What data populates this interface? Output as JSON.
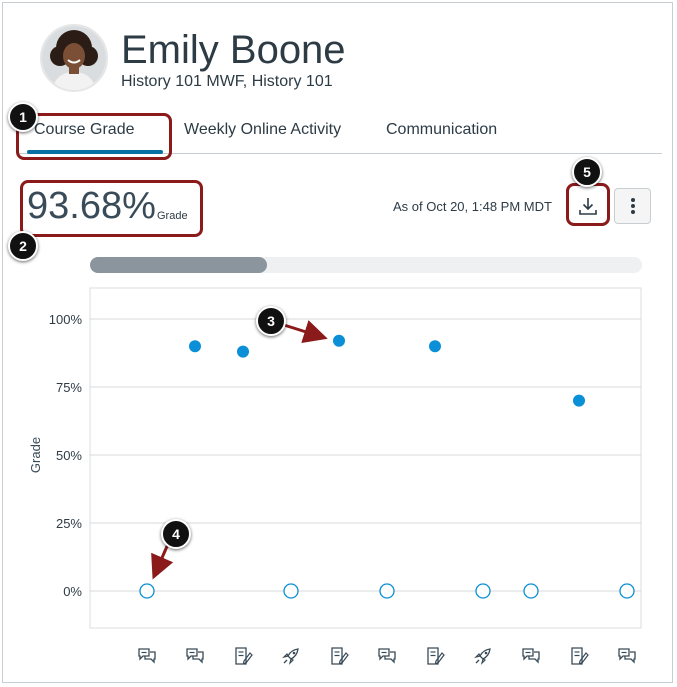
{
  "student": {
    "name": "Emily Boone",
    "course": "History 101 MWF, History 101"
  },
  "tabs": [
    {
      "label": "Course Grade",
      "active": true
    },
    {
      "label": "Weekly Online Activity",
      "active": false
    },
    {
      "label": "Communication",
      "active": false
    }
  ],
  "grade": {
    "value": "93.68%",
    "label": "Grade",
    "as_of": "As of Oct 20, 1:48 PM MDT"
  },
  "scrollbar": {
    "visible_fraction": 0.32
  },
  "callouts": [
    "1",
    "2",
    "3",
    "4",
    "5"
  ],
  "icons": {
    "download": "download-icon",
    "more": "more-vertical-icon",
    "assignment_types": [
      "discussion",
      "discussion",
      "assignment",
      "quiz",
      "assignment",
      "discussion",
      "assignment",
      "quiz",
      "discussion",
      "assignment",
      "discussion"
    ]
  },
  "colors": {
    "accent": "#0770a3",
    "point": "#0b8fd7",
    "callout": "#8b1a1a"
  },
  "chart_data": {
    "type": "scatter",
    "ylabel": "Grade",
    "yticks": [
      "100%",
      "75%",
      "50%",
      "25%",
      "0%"
    ],
    "ylim": [
      0,
      100
    ],
    "grid": true,
    "x": [
      1,
      2,
      3,
      4,
      5,
      6,
      7,
      8,
      9,
      10,
      11
    ],
    "series": [
      {
        "values": [
          null,
          90,
          88,
          null,
          92,
          null,
          90,
          null,
          null,
          70,
          null
        ]
      },
      {
        "values": [
          0,
          null,
          null,
          0,
          null,
          0,
          null,
          0,
          0,
          null,
          0
        ]
      }
    ]
  }
}
